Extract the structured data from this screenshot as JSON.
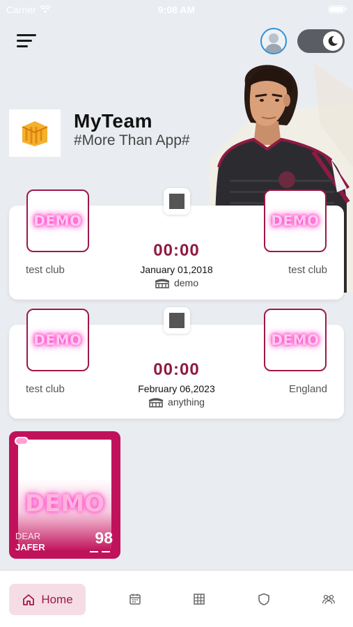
{
  "status_bar": {
    "carrier": "Carrier",
    "time": "9:08 AM"
  },
  "header": {
    "title": "MyTeam",
    "subtitle": "#More Than App#"
  },
  "colors": {
    "accent": "#9c1846",
    "card_bg": "#c0125a",
    "nav_active_bg": "#f6dde5"
  },
  "matches": [
    {
      "home_badge": "DEMO",
      "away_badge": "DEMO",
      "home_club": "test club",
      "away_club": "test club",
      "score": "00:00",
      "date": "January 01,2018",
      "venue": "demo"
    },
    {
      "home_badge": "DEMO",
      "away_badge": "DEMO",
      "home_club": "test club",
      "away_club": "England",
      "score": "00:00",
      "date": "February 06,2023",
      "venue": "anything"
    }
  ],
  "player_card": {
    "badge": "DEMO",
    "first_name": "DEAR",
    "last_name": "JAFER",
    "rating": "98"
  },
  "bottom_nav": {
    "home_label": "Home",
    "icons": [
      "calendar-icon",
      "table-icon",
      "shield-icon",
      "team-icon"
    ]
  }
}
